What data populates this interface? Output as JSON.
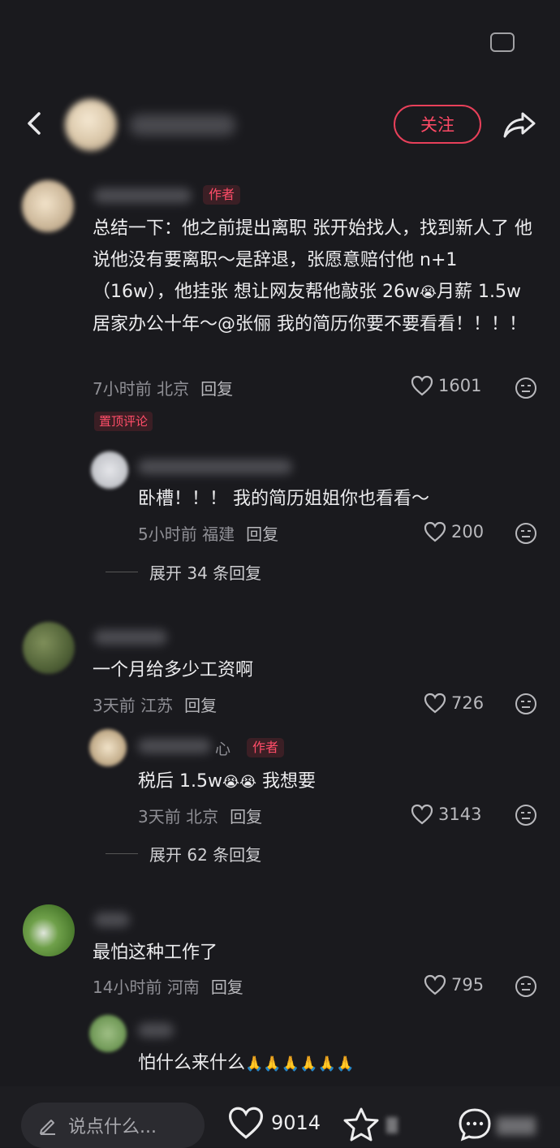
{
  "header": {
    "follow_label": "关注"
  },
  "comments": [
    {
      "author_badge": "作者",
      "text_parts": [
        "总结一下：他之前提出离职 张开始找人，找到新人了 他说他没有要离职～是辞退，张愿意赔付他 n+1（16w），他挂张 想让网友帮他敲张 26w",
        "😭",
        "月薪 1.5w 居家办公十年～@张俪  我的简历你要不要看看！！！！"
      ],
      "time": "7小时前",
      "location": "北京",
      "reply_label": "回复",
      "likes": "1601",
      "pin_label": "置顶评论",
      "replies": [
        {
          "text": "卧槽！！！ 我的简历姐姐你也看看～",
          "time": "5小时前",
          "location": "福建",
          "reply_label": "回复",
          "likes": "200"
        }
      ],
      "expand_label": "展开 34 条回复"
    },
    {
      "text": "一个月给多少工资啊",
      "time": "3天前",
      "location": "江苏",
      "reply_label": "回复",
      "likes": "726",
      "replies": [
        {
          "name_tail": "心",
          "author_badge": "作者",
          "text_a": "税后 1.5w",
          "emoji": "😭😭",
          "text_b": " 我想要",
          "time": "3天前",
          "location": "北京",
          "reply_label": "回复",
          "likes": "3143"
        }
      ],
      "expand_label": "展开 62 条回复"
    },
    {
      "text": "最怕这种工作了",
      "time": "14小时前",
      "location": "河南",
      "reply_label": "回复",
      "likes": "795",
      "replies": [
        {
          "text": "怕什么来什么",
          "emoji": "🙏🙏🙏🙏🙏🙏"
        }
      ]
    }
  ],
  "bottom_bar": {
    "input_placeholder": "说点什么...",
    "likes": "9014"
  },
  "colors": {
    "background": "#1a1a1e",
    "accent": "#ff4a66"
  }
}
